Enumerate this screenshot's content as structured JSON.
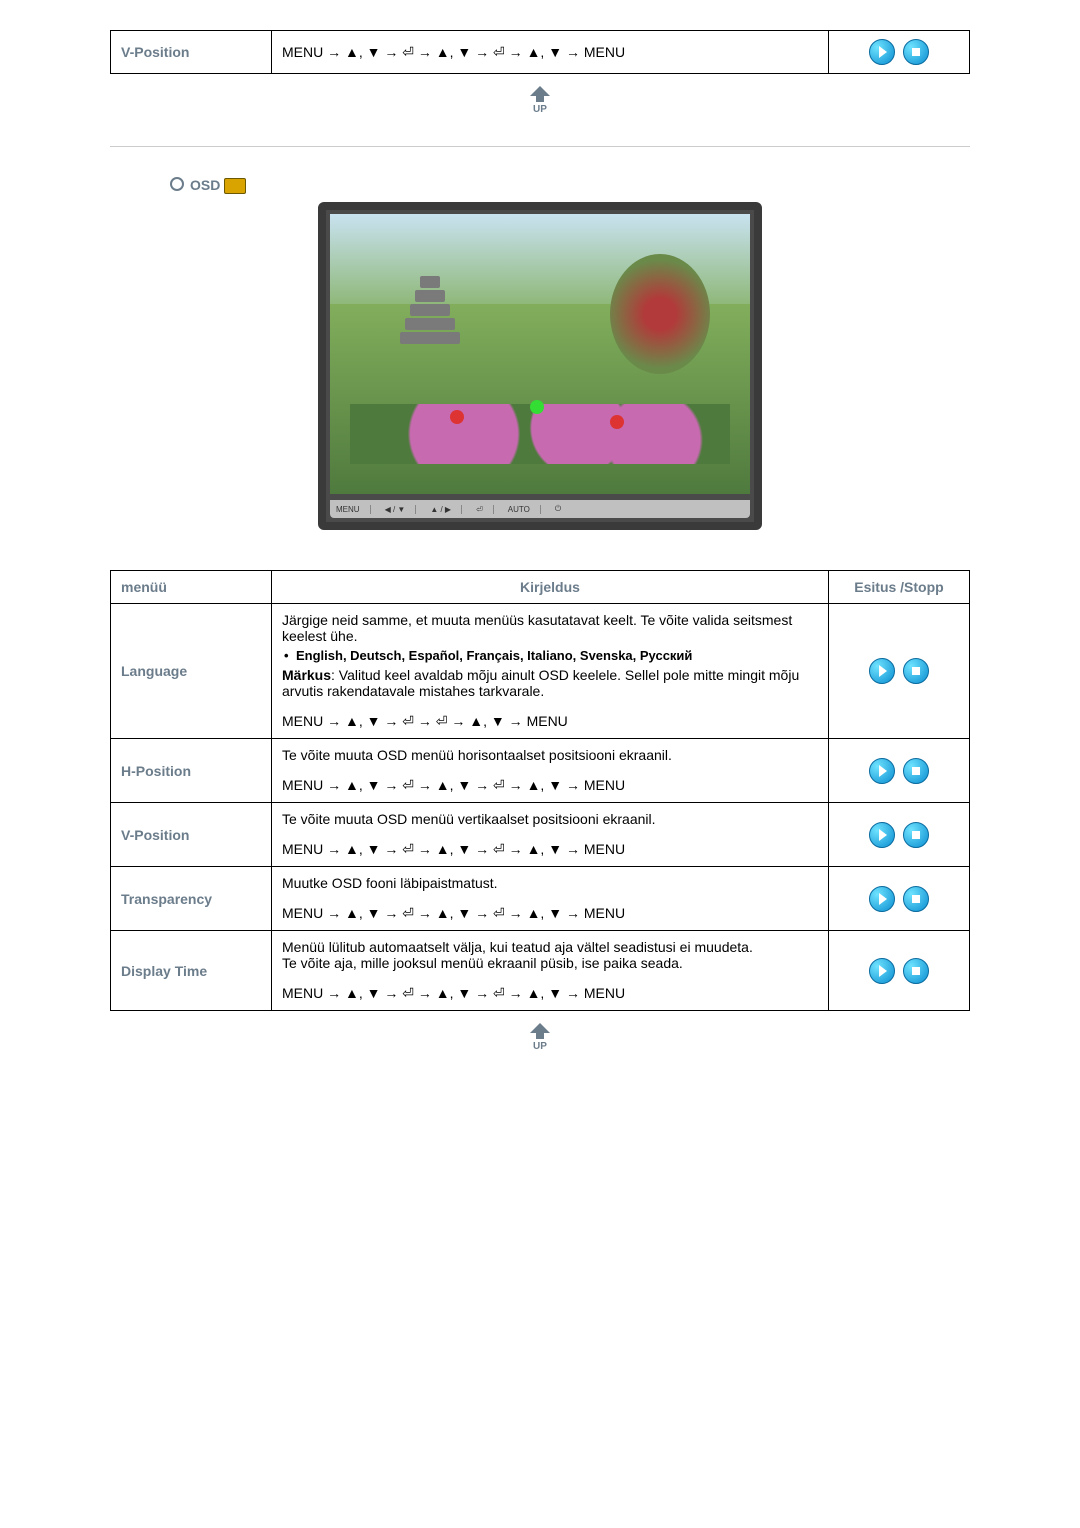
{
  "top_row": {
    "menu_label": "V-Position",
    "sequence": "MENU → ▲, ▼ → ⏎ → ▲, ▼ → ⏎ → ▲, ▼ → MENU"
  },
  "up_label": "UP",
  "section_title": "OSD",
  "monitor_buttons": [
    "MENU",
    "◀ / ▼",
    "▲ / ▶",
    "⏎",
    "AUTO",
    "⏻"
  ],
  "table_headers": {
    "menu": "menüü",
    "desc": "Kirjeldus",
    "action": "Esitus /Stopp"
  },
  "rows": {
    "language": {
      "label": "Language",
      "line1": "Järgige neid samme, et muuta menüüs kasutatavat keelt. Te võite valida seitsmest keelest ühe.",
      "langs": "English, Deutsch, Español, Français, Italiano, Svenska, Русский",
      "note_label": "Märkus",
      "note_text": ": Valitud keel avaldab mõju ainult OSD keelele. Sellel pole mitte mingit mõju arvutis rakendatavale mistahes tarkvarale.",
      "sequence": "MENU → ▲, ▼ → ⏎ → ⏎ → ▲, ▼ → MENU"
    },
    "hpos": {
      "label": "H-Position",
      "text": "Te võite muuta OSD menüü horisontaalset positsiooni ekraanil.",
      "sequence": "MENU → ▲, ▼ → ⏎ → ▲, ▼ → ⏎ → ▲, ▼ → MENU"
    },
    "vpos": {
      "label": "V-Position",
      "text": "Te võite muuta OSD menüü vertikaalset positsiooni ekraanil.",
      "sequence": "MENU → ▲, ▼ → ⏎ → ▲, ▼ → ⏎ → ▲, ▼ → MENU"
    },
    "transparency": {
      "label": "Transparency",
      "text": "Muutke OSD fooni läbipaistmatust.",
      "sequence": "MENU → ▲, ▼ → ⏎ → ▲, ▼ → ⏎ → ▲, ▼ → MENU"
    },
    "display_time": {
      "label": "Display Time",
      "line1": "Menüü lülitub automaatselt välja, kui teatud aja vältel seadistusi ei muudeta.",
      "line2": "Te võite aja, mille jooksul menüü ekraanil püsib, ise paika seada.",
      "sequence": "MENU → ▲, ▼ → ⏎ → ▲, ▼ → ⏎ → ▲, ▼ → MENU"
    }
  }
}
